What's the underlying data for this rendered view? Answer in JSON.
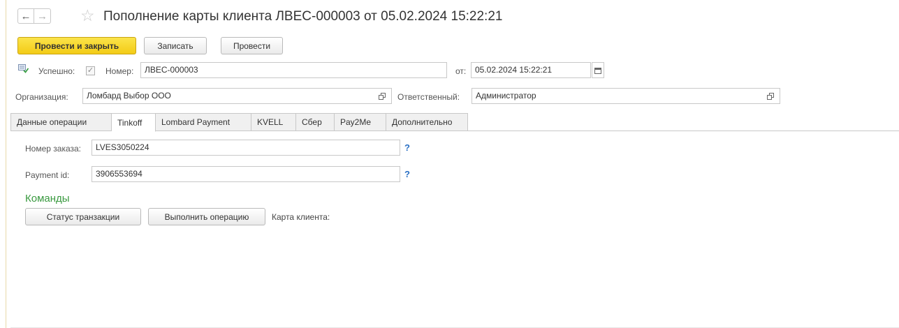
{
  "window": {
    "title": "Пополнение карты клиента ЛВЕС-000003 от 05.02.2024 15:22:21"
  },
  "toolbar": {
    "post_close_label": "Провести и закрыть",
    "save_label": "Записать",
    "post_label": "Провести"
  },
  "header": {
    "success_label": "Успешно:",
    "success_checked": true,
    "number_label": "Номер:",
    "number_value": "ЛВЕС-000003",
    "date_label": "от:",
    "date_value": "05.02.2024 15:22:21",
    "org_label": "Организация:",
    "org_value": "Ломбард Выбор ООО",
    "responsible_label": "Ответственный:",
    "responsible_value": "Администратор"
  },
  "tabs": [
    {
      "label": "Данные операции",
      "active": false
    },
    {
      "label": "Tinkoff",
      "active": true
    },
    {
      "label": "Lombard Payment",
      "active": false
    },
    {
      "label": "KVELL",
      "active": false
    },
    {
      "label": "Сбер",
      "active": false
    },
    {
      "label": "Pay2Me",
      "active": false
    },
    {
      "label": "Дополнительно",
      "active": false
    }
  ],
  "tinkoff": {
    "order_label": "Номер заказа:",
    "order_value": "LVES3050224",
    "payment_label": "Payment id:",
    "payment_value": "3906553694",
    "help_mark": "?"
  },
  "commands": {
    "title": "Команды",
    "status_label": "Статус транзакции",
    "execute_label": "Выполнить операцию",
    "card_label": "Карта клиента:"
  },
  "colors": {
    "primary_button": "#f3cb16",
    "section_title": "#3a9a40",
    "help_link": "#2a70c4"
  }
}
